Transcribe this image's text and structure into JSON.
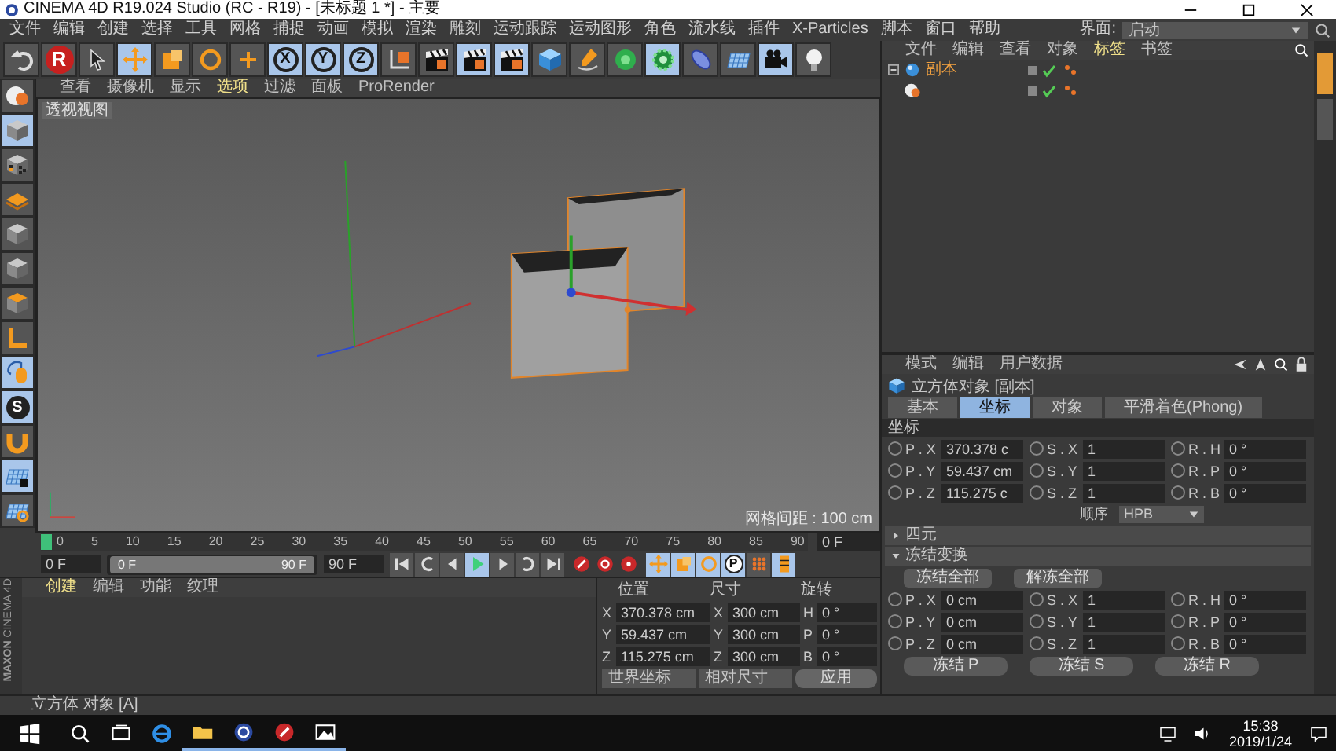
{
  "window": {
    "title": "CINEMA 4D R19.024 Studio (RC - R19) - [未标题 1 *] - 主要"
  },
  "menu": [
    "文件",
    "编辑",
    "创建",
    "选择",
    "工具",
    "网格",
    "捕捉",
    "动画",
    "模拟",
    "渲染",
    "雕刻",
    "运动跟踪",
    "运动图形",
    "角色",
    "流水线",
    "插件",
    "X-Particles",
    "脚本",
    "窗口",
    "帮助"
  ],
  "layout_picker": {
    "label": "界面:",
    "value": "启动"
  },
  "toolbar": [
    {
      "kind": "undo",
      "selected": false
    },
    {
      "kind": "logo",
      "text": "R",
      "selected": false
    },
    {
      "kind": "select",
      "selected": false
    },
    {
      "kind": "move",
      "selected": true
    },
    {
      "kind": "scale",
      "selected": false
    },
    {
      "kind": "rotate",
      "selected": false
    },
    {
      "kind": "add",
      "selected": false
    },
    {
      "kind": "axis",
      "text": "X",
      "selected": true
    },
    {
      "kind": "axis",
      "text": "Y",
      "selected": true
    },
    {
      "kind": "axis",
      "text": "Z",
      "selected": true
    },
    {
      "kind": "coords",
      "selected": false
    },
    {
      "kind": "clapper",
      "selected": false
    },
    {
      "kind": "clapper",
      "selected": true
    },
    {
      "kind": "clapper",
      "selected": true
    },
    {
      "kind": "cube",
      "selected": false
    },
    {
      "kind": "pen",
      "selected": false
    },
    {
      "kind": "gem",
      "selected": false
    },
    {
      "kind": "gear",
      "selected": true
    },
    {
      "kind": "capsule",
      "selected": false
    },
    {
      "kind": "grid",
      "selected": false
    },
    {
      "kind": "camera",
      "selected": true
    },
    {
      "kind": "bulb",
      "selected": false
    }
  ],
  "left_toolbar": [
    {
      "kind": "sphere",
      "selected": false
    },
    {
      "kind": "box",
      "selected": true
    },
    {
      "kind": "checker",
      "selected": false
    },
    {
      "kind": "layers",
      "selected": false
    },
    {
      "kind": "box",
      "selected": false
    },
    {
      "kind": "box",
      "selected": false
    },
    {
      "kind": "box-top",
      "selected": false
    },
    {
      "kind": "corner",
      "selected": false
    },
    {
      "kind": "mouse",
      "selected": true
    },
    {
      "kind": "snap",
      "text": "S",
      "selected": true
    },
    {
      "kind": "magnet",
      "selected": false
    },
    {
      "kind": "grid-lock",
      "selected": true
    },
    {
      "kind": "grid-ring",
      "selected": false
    }
  ],
  "viewport": {
    "menu": [
      {
        "label": "查看",
        "selected": false
      },
      {
        "label": "摄像机",
        "selected": false
      },
      {
        "label": "显示",
        "selected": false
      },
      {
        "label": "选项",
        "selected": true
      },
      {
        "label": "过滤",
        "selected": false
      },
      {
        "label": "面板",
        "selected": false
      },
      {
        "label": "ProRender",
        "selected": false
      }
    ],
    "label": "透视视图",
    "grid_info": "网格间距 : 100 cm"
  },
  "timeline": {
    "ticks": [
      "0",
      "5",
      "10",
      "15",
      "20",
      "25",
      "30",
      "35",
      "40",
      "45",
      "50",
      "55",
      "60",
      "65",
      "70",
      "75",
      "80",
      "85",
      "90"
    ],
    "playhead": {
      "level": 0
    },
    "current_frame": "0 F",
    "start": "0 F",
    "range": {
      "level": 1
    },
    "range_start": "0 F",
    "range_end": "90 F",
    "end": "90 F",
    "transport": [
      {
        "kind": "to-start",
        "selected": false
      },
      {
        "kind": "loop-back",
        "selected": false
      },
      {
        "kind": "prev",
        "selected": false
      },
      {
        "kind": "play",
        "selected": true
      },
      {
        "kind": "next",
        "selected": false
      },
      {
        "kind": "loop",
        "selected": false
      },
      {
        "kind": "to-end",
        "selected": false
      }
    ],
    "record": [
      {
        "kind": "record"
      },
      {
        "kind": "autokey"
      },
      {
        "kind": "keyframe"
      }
    ],
    "keys": [
      {
        "kind": "move",
        "selected": true
      },
      {
        "kind": "scale",
        "selected": true
      },
      {
        "kind": "rotate",
        "selected": true
      },
      {
        "kind": "param",
        "text": "P",
        "selected": true
      },
      {
        "kind": "dots",
        "selected": false
      },
      {
        "kind": "bars",
        "selected": true
      }
    ]
  },
  "material_manager": {
    "menu": [
      "创建",
      "编辑",
      "功能",
      "纹理"
    ],
    "logo": "MAXON",
    "logo_sub": "CINEMA 4D"
  },
  "coordinates": {
    "headers": [
      "位置",
      "尺寸",
      "旋转"
    ],
    "rows": [
      {
        "axis": "X",
        "position": "370.378 cm",
        "size_axis": "X",
        "size": "300 cm",
        "rot_axis": "H",
        "rotation": "0 °"
      },
      {
        "axis": "Y",
        "position": "59.437 cm",
        "size_axis": "Y",
        "size": "300 cm",
        "rot_axis": "P",
        "rotation": "0 °"
      },
      {
        "axis": "Z",
        "position": "115.275 cm",
        "size_axis": "Z",
        "size": "300 cm",
        "rot_axis": "B",
        "rotation": "0 °"
      }
    ],
    "space": "世界坐标",
    "size_mode": "相对尺寸",
    "apply": "应用"
  },
  "objects": {
    "menu": [
      {
        "label": "文件",
        "selected": false
      },
      {
        "label": "编辑",
        "selected": false
      },
      {
        "label": "查看",
        "selected": false
      },
      {
        "label": "对象",
        "selected": false
      },
      {
        "label": "标签",
        "selected": true
      },
      {
        "label": "书签",
        "selected": false
      }
    ],
    "items": [
      {
        "kind": "instance",
        "name": "副本",
        "selected": true,
        "expanded": true,
        "children": [
          {
            "kind": "sphere"
          }
        ]
      }
    ]
  },
  "side_tabs": [
    {
      "selected": true
    },
    {
      "selected": false
    }
  ],
  "attributes": {
    "menu": [
      "模式",
      "编辑",
      "用户数据"
    ],
    "title": "立方体对象 [副本]",
    "tabs": [
      {
        "label": "基本",
        "selected": false
      },
      {
        "label": "坐标",
        "selected": true
      },
      {
        "label": "对象",
        "selected": false
      },
      {
        "label": "平滑着色(Phong)",
        "selected": false
      }
    ],
    "section": "坐标",
    "rows": [
      {
        "fields": [
          {
            "label": "P . X",
            "value": "370.378 c"
          },
          {
            "label": "S . X",
            "value": "1"
          },
          {
            "label": "R . H",
            "value": "0 °"
          }
        ]
      },
      {
        "fields": [
          {
            "label": "P . Y",
            "value": "59.437 cm"
          },
          {
            "label": "S . Y",
            "value": "1"
          },
          {
            "label": "R . P",
            "value": "0 °"
          }
        ]
      },
      {
        "fields": [
          {
            "label": "P . Z",
            "value": "115.275 c"
          },
          {
            "label": "S . Z",
            "value": "1"
          },
          {
            "label": "R . B",
            "value": "0 °"
          }
        ]
      }
    ],
    "order": {
      "label": "顺序",
      "value": "HPB"
    },
    "groups": [
      {
        "label": "四元",
        "expanded": false
      },
      {
        "label": "冻结变换",
        "expanded": true,
        "buttons": [
          "冻结全部",
          "解冻全部"
        ],
        "rows": [
          {
            "fields": [
              {
                "label": "P . X",
                "value": "0 cm"
              },
              {
                "label": "S . X",
                "value": "1"
              },
              {
                "label": "R . H",
                "value": "0 °"
              }
            ]
          },
          {
            "fields": [
              {
                "label": "P . Y",
                "value": "0 cm"
              },
              {
                "label": "S . Y",
                "value": "1"
              },
              {
                "label": "R . P",
                "value": "0 °"
              }
            ]
          },
          {
            "fields": [
              {
                "label": "P . Z",
                "value": "0 cm"
              },
              {
                "label": "S . Z",
                "value": "1"
              },
              {
                "label": "R . B",
                "value": "0 °"
              }
            ]
          }
        ],
        "freeze_buttons": [
          "冻结 P",
          "冻结 S",
          "冻结 R"
        ]
      }
    ]
  },
  "status": "立方体 对象 [A]",
  "taskbar": {
    "apps": [
      {
        "kind": "search",
        "running": false
      },
      {
        "kind": "task-view",
        "running": false
      },
      {
        "kind": "browser",
        "running": false
      },
      {
        "kind": "folder",
        "running": true
      },
      {
        "kind": "app-sphere",
        "running": true
      },
      {
        "kind": "record",
        "running": true
      },
      {
        "kind": "photos",
        "running": true
      }
    ],
    "time": "15:38",
    "date": "2019/1/24"
  }
}
